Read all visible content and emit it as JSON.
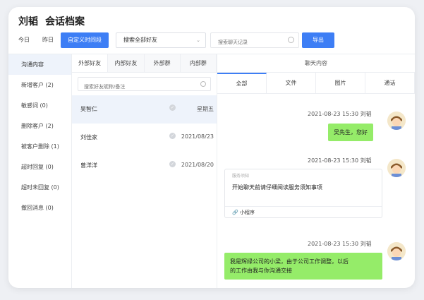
{
  "header": {
    "name": "刘韬",
    "title": "会话档案"
  },
  "toolbar": {
    "today": "今日",
    "yesterday": "昨日",
    "custom_range": "自定义时间段",
    "select_value": "搜索全部好友",
    "search_placeholder": "搜索聊天记录",
    "export": "导出"
  },
  "sidebar": {
    "items": [
      {
        "label": "沟通内容"
      },
      {
        "label": "新增客户 (2)"
      },
      {
        "label": "敏感词 (0)"
      },
      {
        "label": "删除客户 (2)"
      },
      {
        "label": "被客户删除 (1)"
      },
      {
        "label": "超时回复 (0)"
      },
      {
        "label": "超时未回复 (0)"
      },
      {
        "label": "撤回消息 (0)"
      }
    ]
  },
  "contacts": {
    "tabs": [
      {
        "label": "外部好友"
      },
      {
        "label": "内部好友"
      },
      {
        "label": "外部群"
      },
      {
        "label": "内部群"
      }
    ],
    "search_placeholder": "搜索好友昵称/备注",
    "list": [
      {
        "name": "吴智仁",
        "date": "星期五"
      },
      {
        "name": "刘佳家",
        "date": "2021/08/23"
      },
      {
        "name": "曾洋洋",
        "date": "2021/08/20"
      }
    ]
  },
  "chat": {
    "header": "聊天内容",
    "tabs": [
      {
        "label": "全部"
      },
      {
        "label": "文件"
      },
      {
        "label": "图片"
      },
      {
        "label": "通话"
      }
    ],
    "messages": [
      {
        "meta": "2021-08-23 15:30   刘韬",
        "text": "吴先生，您好"
      },
      {
        "meta": "2021-08-23 15:30   刘韬",
        "source": "服务须知",
        "text": "开始聊天前请仔细阅读服务须知事项",
        "footer": "小程序"
      },
      {
        "meta": "2021-08-23 15:30   刘韬",
        "text_line1": "我是辉绿公司的小梁，由于公司工作调整，以后",
        "text_line2": "的工作由我与你沟通交接"
      }
    ]
  },
  "colors": {
    "accent": "#3d7ef5",
    "bubble": "#95ec69",
    "selected_bg": "#eef3fb"
  }
}
